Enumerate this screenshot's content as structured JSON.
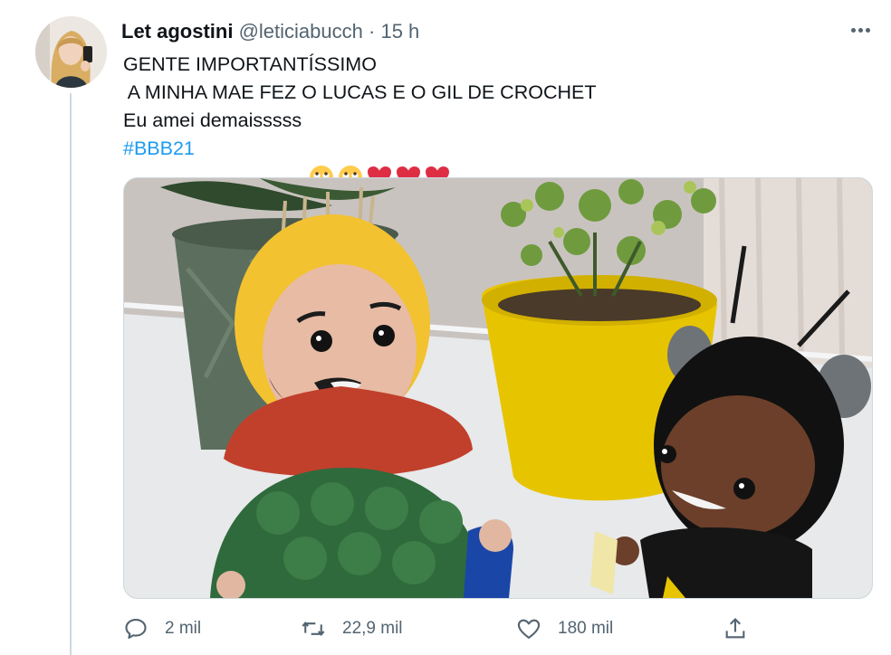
{
  "tweet": {
    "display_name": "Let agostini",
    "handle": "@leticiabucch",
    "separator": "·",
    "time": "15 h",
    "lines": [
      "GENTE IMPORTANTÍSSIMO",
      " A MINHA MAE FEZ O LUCAS E O GIL DE CROCHET",
      "Eu amei demaisssss"
    ],
    "hashtag": "#BBB21",
    "emojis": [
      "face-with-rolling-eyes-icon",
      "face-with-rolling-eyes-icon",
      "red-heart-icon",
      "red-heart-icon",
      "red-heart-icon"
    ]
  },
  "actions": {
    "replies": "2 mil",
    "retweets": "22,9 mil",
    "likes": "180 mil"
  },
  "icons": {
    "reply": "reply-bubble-icon",
    "retweet": "retweet-icon",
    "like": "heart-outline-icon",
    "share": "share-icon",
    "more": "more-dots-icon"
  },
  "colors": {
    "text": "#0f1419",
    "muted": "#536471",
    "link": "#1d9bf0",
    "heart": "#e0245e",
    "border": "#cfd9de"
  }
}
